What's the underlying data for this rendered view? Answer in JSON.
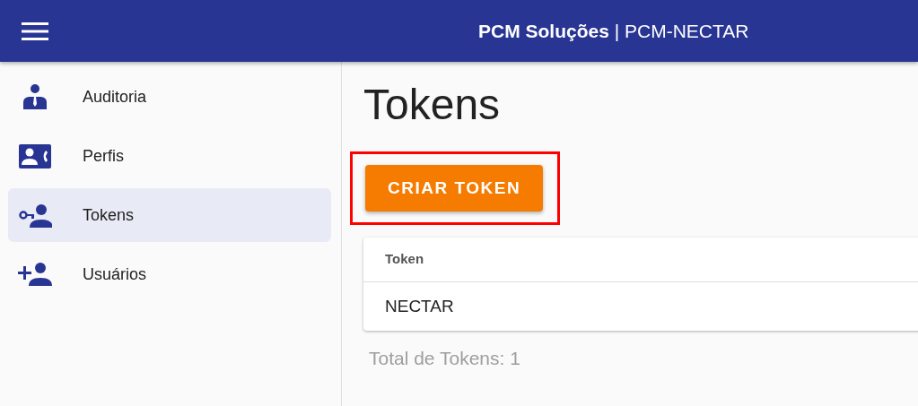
{
  "header": {
    "title": "**PCM Soluções** | PCM-NECTAR"
  },
  "sidebar": {
    "items": [
      {
        "label": "Auditoria",
        "kind": "auditor",
        "selected": false
      },
      {
        "label": "Perfis",
        "kind": "contact",
        "selected": false
      },
      {
        "label": "Tokens",
        "kind": "key",
        "selected": true
      },
      {
        "label": "Usuários",
        "kind": "add-user",
        "selected": false
      }
    ]
  },
  "page": {
    "heading": "Tokens",
    "create_button": {
      "label": "CRIAR TOKEN",
      "highlighted": true
    },
    "table": {
      "columns": [
        "Token"
      ],
      "rows": [
        [
          "NECTAR"
        ]
      ]
    },
    "total": "Total de Tokens: 1"
  }
}
